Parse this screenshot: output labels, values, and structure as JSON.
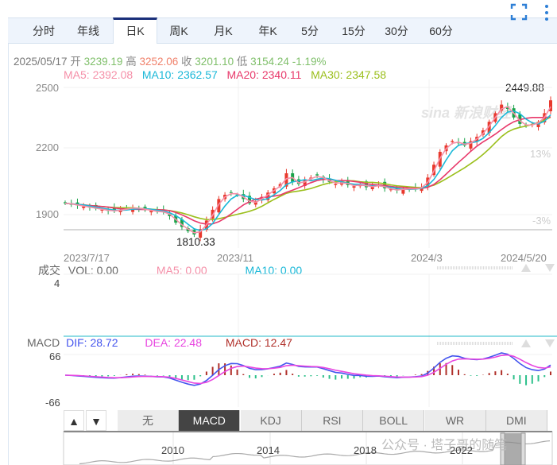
{
  "tabs": [
    {
      "label": "分时"
    },
    {
      "label": "年线"
    },
    {
      "label": "日K",
      "active": true
    },
    {
      "label": "周K"
    },
    {
      "label": "月K"
    },
    {
      "label": "年K"
    },
    {
      "label": "5分"
    },
    {
      "label": "15分"
    },
    {
      "label": "30分"
    },
    {
      "label": "60分"
    }
  ],
  "toolbar": {
    "fullscreen_icon": "fullscreen-icon",
    "more_icon": "more-vertical-icon"
  },
  "quote": {
    "date": "2025/05/17",
    "open_label": "开",
    "open": "3239.19",
    "high_label": "高",
    "high": "3252.06",
    "close_label": "收",
    "close": "3201.10",
    "low_label": "低",
    "low": "3154.24",
    "change": "-1.19%"
  },
  "ma": {
    "ma5": "MA5: 2392.08",
    "ma10": "MA10: 2362.57",
    "ma20": "MA20: 2340.11",
    "ma30": "MA30: 2347.58"
  },
  "colors": {
    "up": "#e8392d",
    "down": "#1aa34a",
    "ma5": "#f58fa8",
    "ma10": "#1ab8d8",
    "ma20": "#e8386a",
    "ma30": "#9bbf1c",
    "dif": "#4455ee",
    "dea": "#e845e0",
    "macd": "#b0302a"
  },
  "price_axis": {
    "ticks": [
      "2500",
      "2200",
      "1900"
    ],
    "pct_ticks": [
      "13%",
      "-3%"
    ]
  },
  "annotations": {
    "max": "2449.88",
    "min": "1810.33"
  },
  "date_axis": [
    "2023/7/17",
    "2023/11",
    "2024/3",
    "2024/5/20"
  ],
  "volume": {
    "label": "成交",
    "vol": "VOL: 0.00",
    "ma5": "MA5: 0.00",
    "ma10": "MA10: 0.00",
    "axis_max": "4"
  },
  "macd": {
    "label": "MACD",
    "dif": "DIF: 28.72",
    "dea": "DEA: 22.48",
    "macd": "MACD: 12.47",
    "axis_max": "66",
    "axis_min": "-66"
  },
  "indicator_tabs": [
    {
      "label": "无"
    },
    {
      "label": "MACD",
      "active": true
    },
    {
      "label": "KDJ"
    },
    {
      "label": "RSI"
    },
    {
      "label": "BOLL"
    },
    {
      "label": "WR"
    },
    {
      "label": "DMI"
    }
  ],
  "navigator": {
    "years": [
      "2010",
      "2014",
      "2018",
      "2022"
    ]
  },
  "watermark": "公众号 · 塔子哥的随笔",
  "logo_watermark": "sina 新浪财经",
  "chart_data": {
    "type": "candlestick",
    "x_labels": [
      "2023/7/17",
      "2023/11",
      "2024/3",
      "2024/5/20"
    ],
    "ylim": [
      1790,
      2520
    ],
    "close": [
      1960,
      1955,
      1950,
      1945,
      1940,
      1935,
      1930,
      1925,
      1925,
      1930,
      1935,
      1940,
      1935,
      1930,
      1925,
      1920,
      1920,
      1900,
      1870,
      1850,
      1830,
      1815,
      1840,
      1880,
      1930,
      1980,
      2000,
      2010,
      2000,
      1980,
      1960,
      1970,
      1990,
      2010,
      2030,
      2050,
      2100,
      2060,
      2050,
      2070,
      2080,
      2090,
      2070,
      2060,
      2050,
      2060,
      2045,
      2040,
      2050,
      2035,
      2040,
      2045,
      2030,
      2025,
      2020,
      2030,
      2025,
      2030,
      2035,
      2080,
      2140,
      2200,
      2230,
      2250,
      2240,
      2230,
      2250,
      2270,
      2300,
      2340,
      2380,
      2420,
      2400,
      2360,
      2330,
      2320,
      2330,
      2340,
      2380,
      2440
    ]
  }
}
